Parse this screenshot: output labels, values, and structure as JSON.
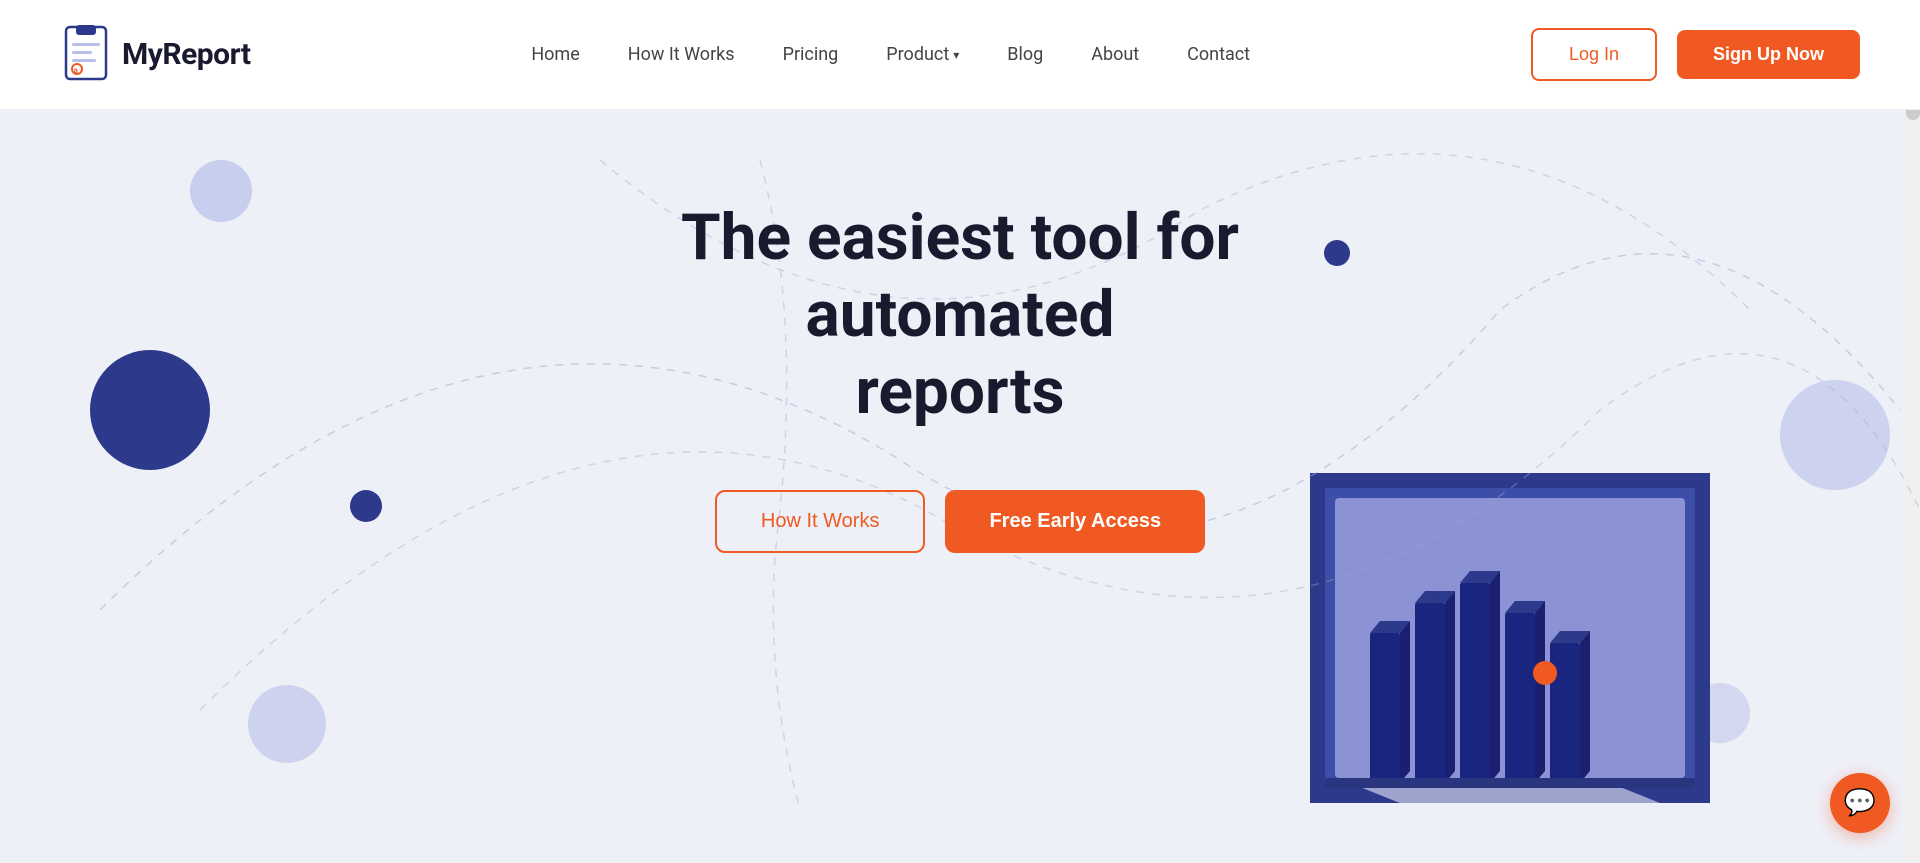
{
  "brand": {
    "name": "MyReport",
    "logo_alt": "MyReport logo"
  },
  "navbar": {
    "links": [
      {
        "id": "home",
        "label": "Home"
      },
      {
        "id": "how-it-works",
        "label": "How It Works"
      },
      {
        "id": "pricing",
        "label": "Pricing"
      },
      {
        "id": "product",
        "label": "Product",
        "has_dropdown": true
      },
      {
        "id": "blog",
        "label": "Blog"
      },
      {
        "id": "about",
        "label": "About"
      },
      {
        "id": "contact",
        "label": "Contact"
      }
    ],
    "login_label": "Log In",
    "signup_label": "Sign Up Now"
  },
  "hero": {
    "title_line1": "The easiest tool for automated",
    "title_line2": "reports",
    "btn_how_works": "How It Works",
    "btn_early_access": "Free Early Access"
  },
  "chat": {
    "icon": "💬"
  },
  "colors": {
    "accent": "#f05a22",
    "dark_blue": "#2d3a8c",
    "light_circle": "#b8bfe8",
    "hero_bg": "#eef0f8"
  }
}
